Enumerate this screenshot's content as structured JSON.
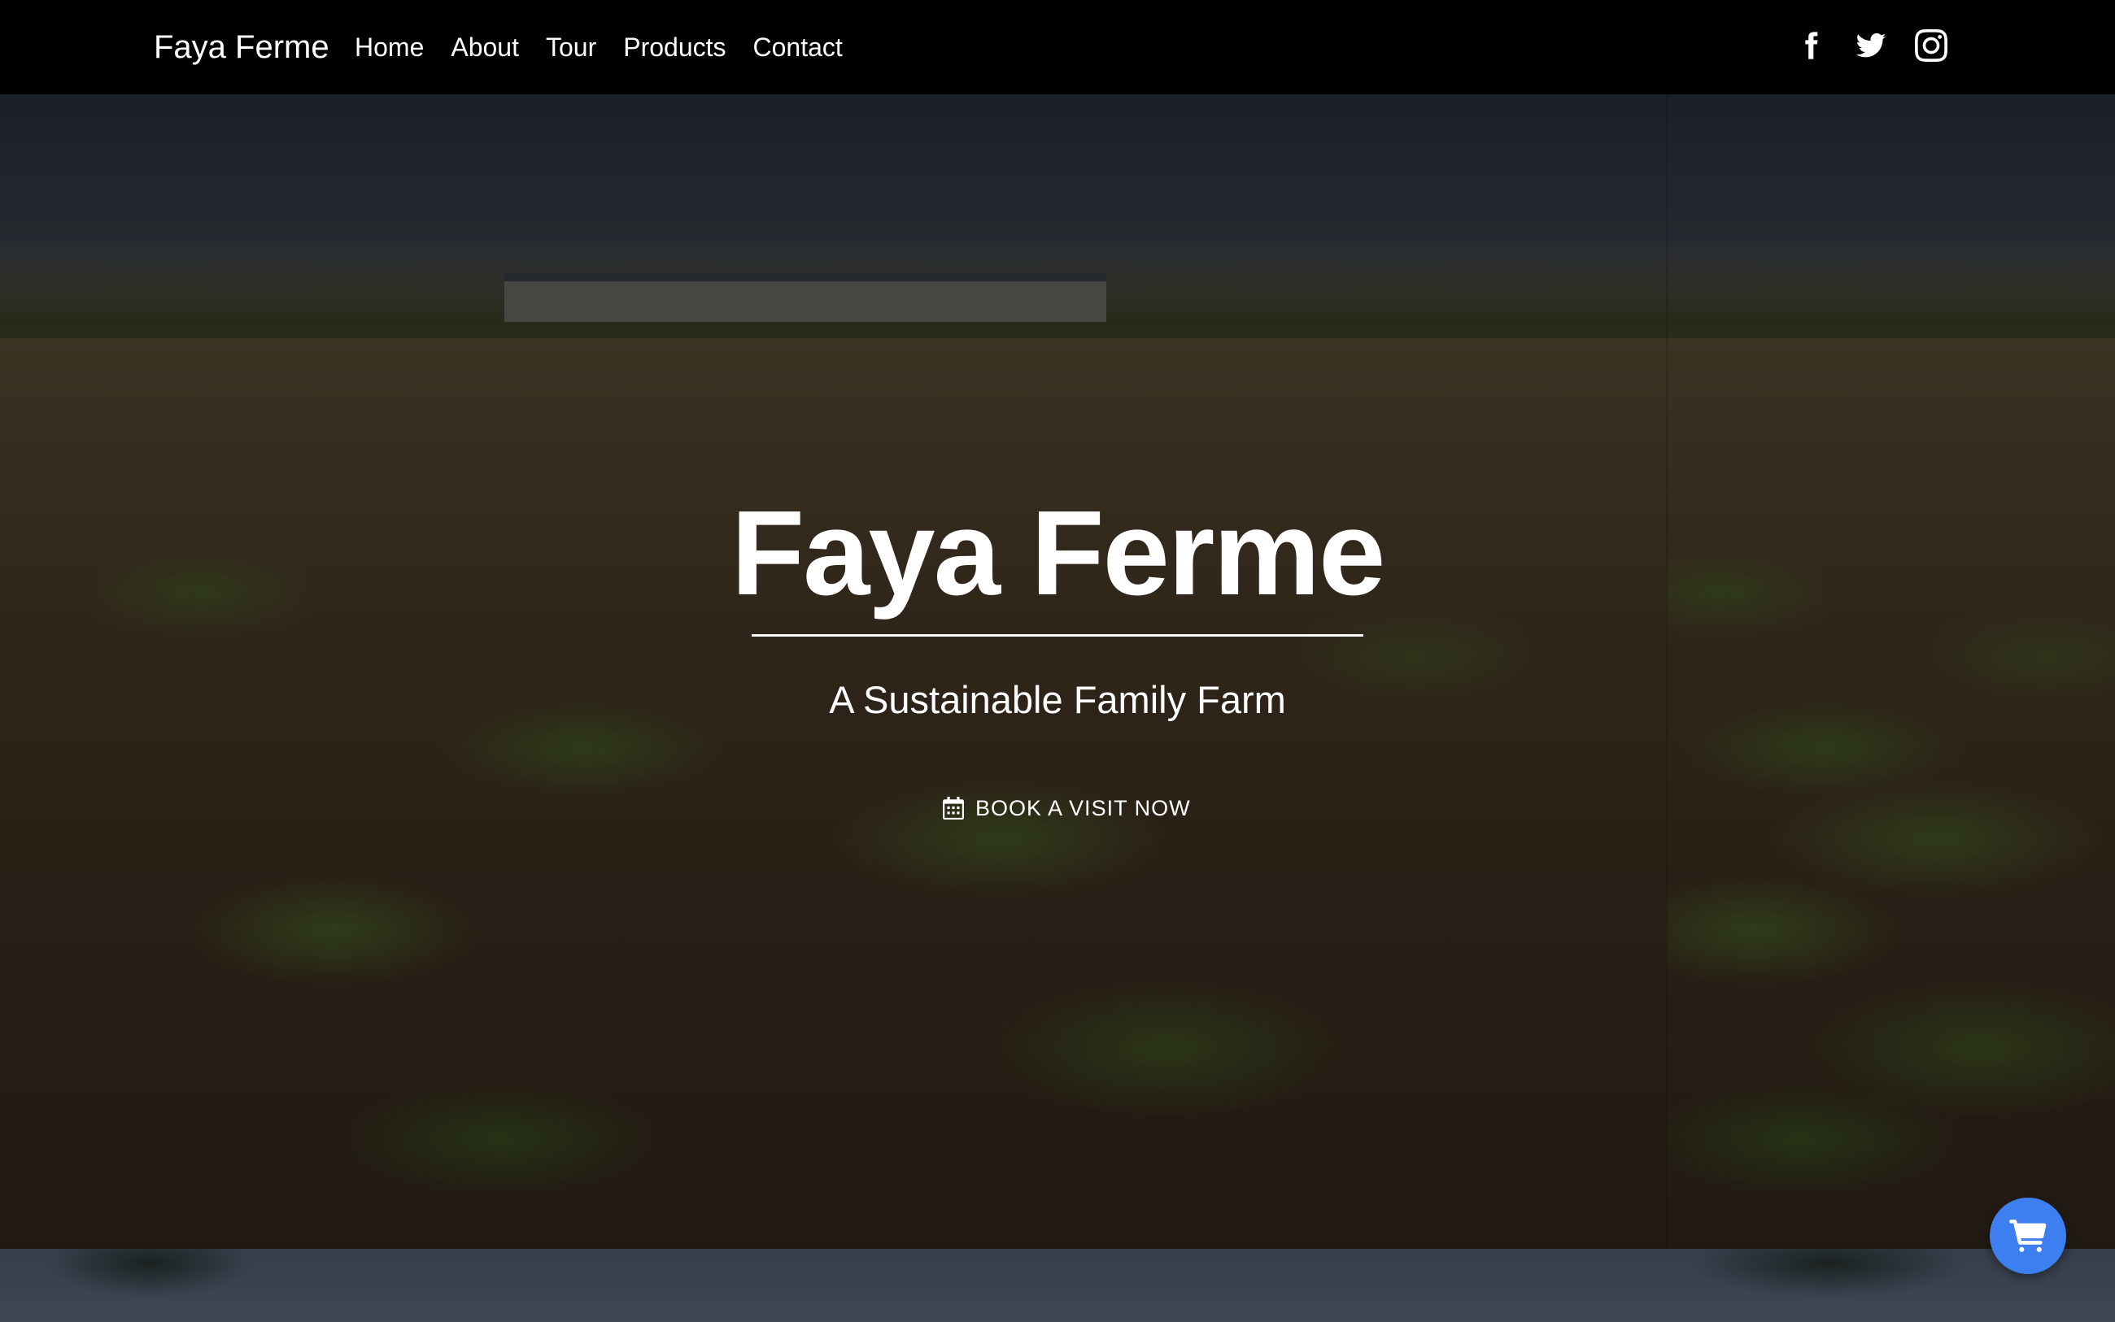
{
  "brand": "Faya Ferme",
  "nav": {
    "items": [
      {
        "label": "Home"
      },
      {
        "label": "About"
      },
      {
        "label": "Tour"
      },
      {
        "label": "Products"
      },
      {
        "label": "Contact"
      }
    ]
  },
  "social": [
    "facebook-icon",
    "twitter-icon",
    "instagram-icon"
  ],
  "hero": {
    "title": "Faya Ferme",
    "subtitle": "A Sustainable Family Farm",
    "cta_label": "BOOK A VISIT NOW",
    "cta_icon": "calendar-icon"
  },
  "cart": {
    "icon": "shopping-cart-icon",
    "color": "#3d7ff0"
  }
}
